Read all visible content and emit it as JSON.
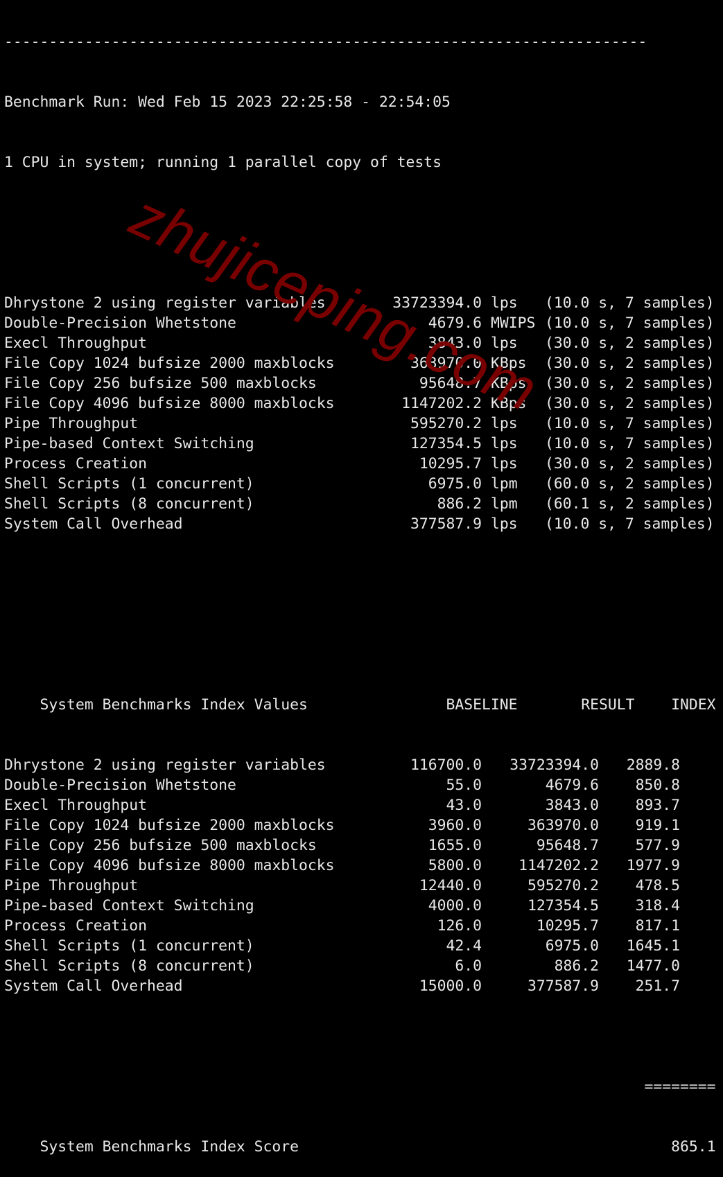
{
  "terminal": {
    "separator": "------------------------------------------------------------------------",
    "run_line": "Benchmark Run: Wed Feb 15 2023 22:25:58 - 22:54:05",
    "cpu_line": "1 CPU in system; running 1 parallel copy of tests",
    "results": [
      {
        "name": "Dhrystone 2 using register variables",
        "value": "33723394.0",
        "unit": "lps",
        "detail": "(10.0 s, 7 samples)"
      },
      {
        "name": "Double-Precision Whetstone",
        "value": "4679.6",
        "unit": "MWIPS",
        "detail": "(10.0 s, 7 samples)"
      },
      {
        "name": "Execl Throughput",
        "value": "3843.0",
        "unit": "lps",
        "detail": "(30.0 s, 2 samples)"
      },
      {
        "name": "File Copy 1024 bufsize 2000 maxblocks",
        "value": "363970.0",
        "unit": "KBps",
        "detail": "(30.0 s, 2 samples)"
      },
      {
        "name": "File Copy 256 bufsize 500 maxblocks",
        "value": "95648.7",
        "unit": "KBps",
        "detail": "(30.0 s, 2 samples)"
      },
      {
        "name": "File Copy 4096 bufsize 8000 maxblocks",
        "value": "1147202.2",
        "unit": "KBps",
        "detail": "(30.0 s, 2 samples)"
      },
      {
        "name": "Pipe Throughput",
        "value": "595270.2",
        "unit": "lps",
        "detail": "(10.0 s, 7 samples)"
      },
      {
        "name": "Pipe-based Context Switching",
        "value": "127354.5",
        "unit": "lps",
        "detail": "(10.0 s, 7 samples)"
      },
      {
        "name": "Process Creation",
        "value": "10295.7",
        "unit": "lps",
        "detail": "(30.0 s, 2 samples)"
      },
      {
        "name": "Shell Scripts (1 concurrent)",
        "value": "6975.0",
        "unit": "lpm",
        "detail": "(60.0 s, 2 samples)"
      },
      {
        "name": "Shell Scripts (8 concurrent)",
        "value": "886.2",
        "unit": "lpm",
        "detail": "(60.1 s, 2 samples)"
      },
      {
        "name": "System Call Overhead",
        "value": "377587.9",
        "unit": "lps",
        "detail": "(10.0 s, 7 samples)"
      }
    ],
    "index_table": {
      "title": "System Benchmarks Index Values",
      "headers": {
        "baseline": "BASELINE",
        "result": "RESULT",
        "index": "INDEX"
      },
      "rows": [
        {
          "name": "Dhrystone 2 using register variables",
          "baseline": "116700.0",
          "result": "33723394.0",
          "index": "2889.8"
        },
        {
          "name": "Double-Precision Whetstone",
          "baseline": "55.0",
          "result": "4679.6",
          "index": "850.8"
        },
        {
          "name": "Execl Throughput",
          "baseline": "43.0",
          "result": "3843.0",
          "index": "893.7"
        },
        {
          "name": "File Copy 1024 bufsize 2000 maxblocks",
          "baseline": "3960.0",
          "result": "363970.0",
          "index": "919.1"
        },
        {
          "name": "File Copy 256 bufsize 500 maxblocks",
          "baseline": "1655.0",
          "result": "95648.7",
          "index": "577.9"
        },
        {
          "name": "File Copy 4096 bufsize 8000 maxblocks",
          "baseline": "5800.0",
          "result": "1147202.2",
          "index": "1977.9"
        },
        {
          "name": "Pipe Throughput",
          "baseline": "12440.0",
          "result": "595270.2",
          "index": "478.5"
        },
        {
          "name": "Pipe-based Context Switching",
          "baseline": "4000.0",
          "result": "127354.5",
          "index": "318.4"
        },
        {
          "name": "Process Creation",
          "baseline": "126.0",
          "result": "10295.7",
          "index": "817.1"
        },
        {
          "name": "Shell Scripts (1 concurrent)",
          "baseline": "42.4",
          "result": "6975.0",
          "index": "1645.1"
        },
        {
          "name": "Shell Scripts (8 concurrent)",
          "baseline": "6.0",
          "result": "886.2",
          "index": "1477.0"
        },
        {
          "name": "System Call Overhead",
          "baseline": "15000.0",
          "result": "377587.9",
          "index": "251.7"
        }
      ],
      "rule": "========",
      "score_label": "System Benchmarks Index Score",
      "score_value": "865.1"
    }
  },
  "watermark": {
    "text": "zhujiceping.com",
    "color": "#7d0000"
  },
  "colors": {
    "background": "#000000",
    "text": "#e8e8e8"
  }
}
